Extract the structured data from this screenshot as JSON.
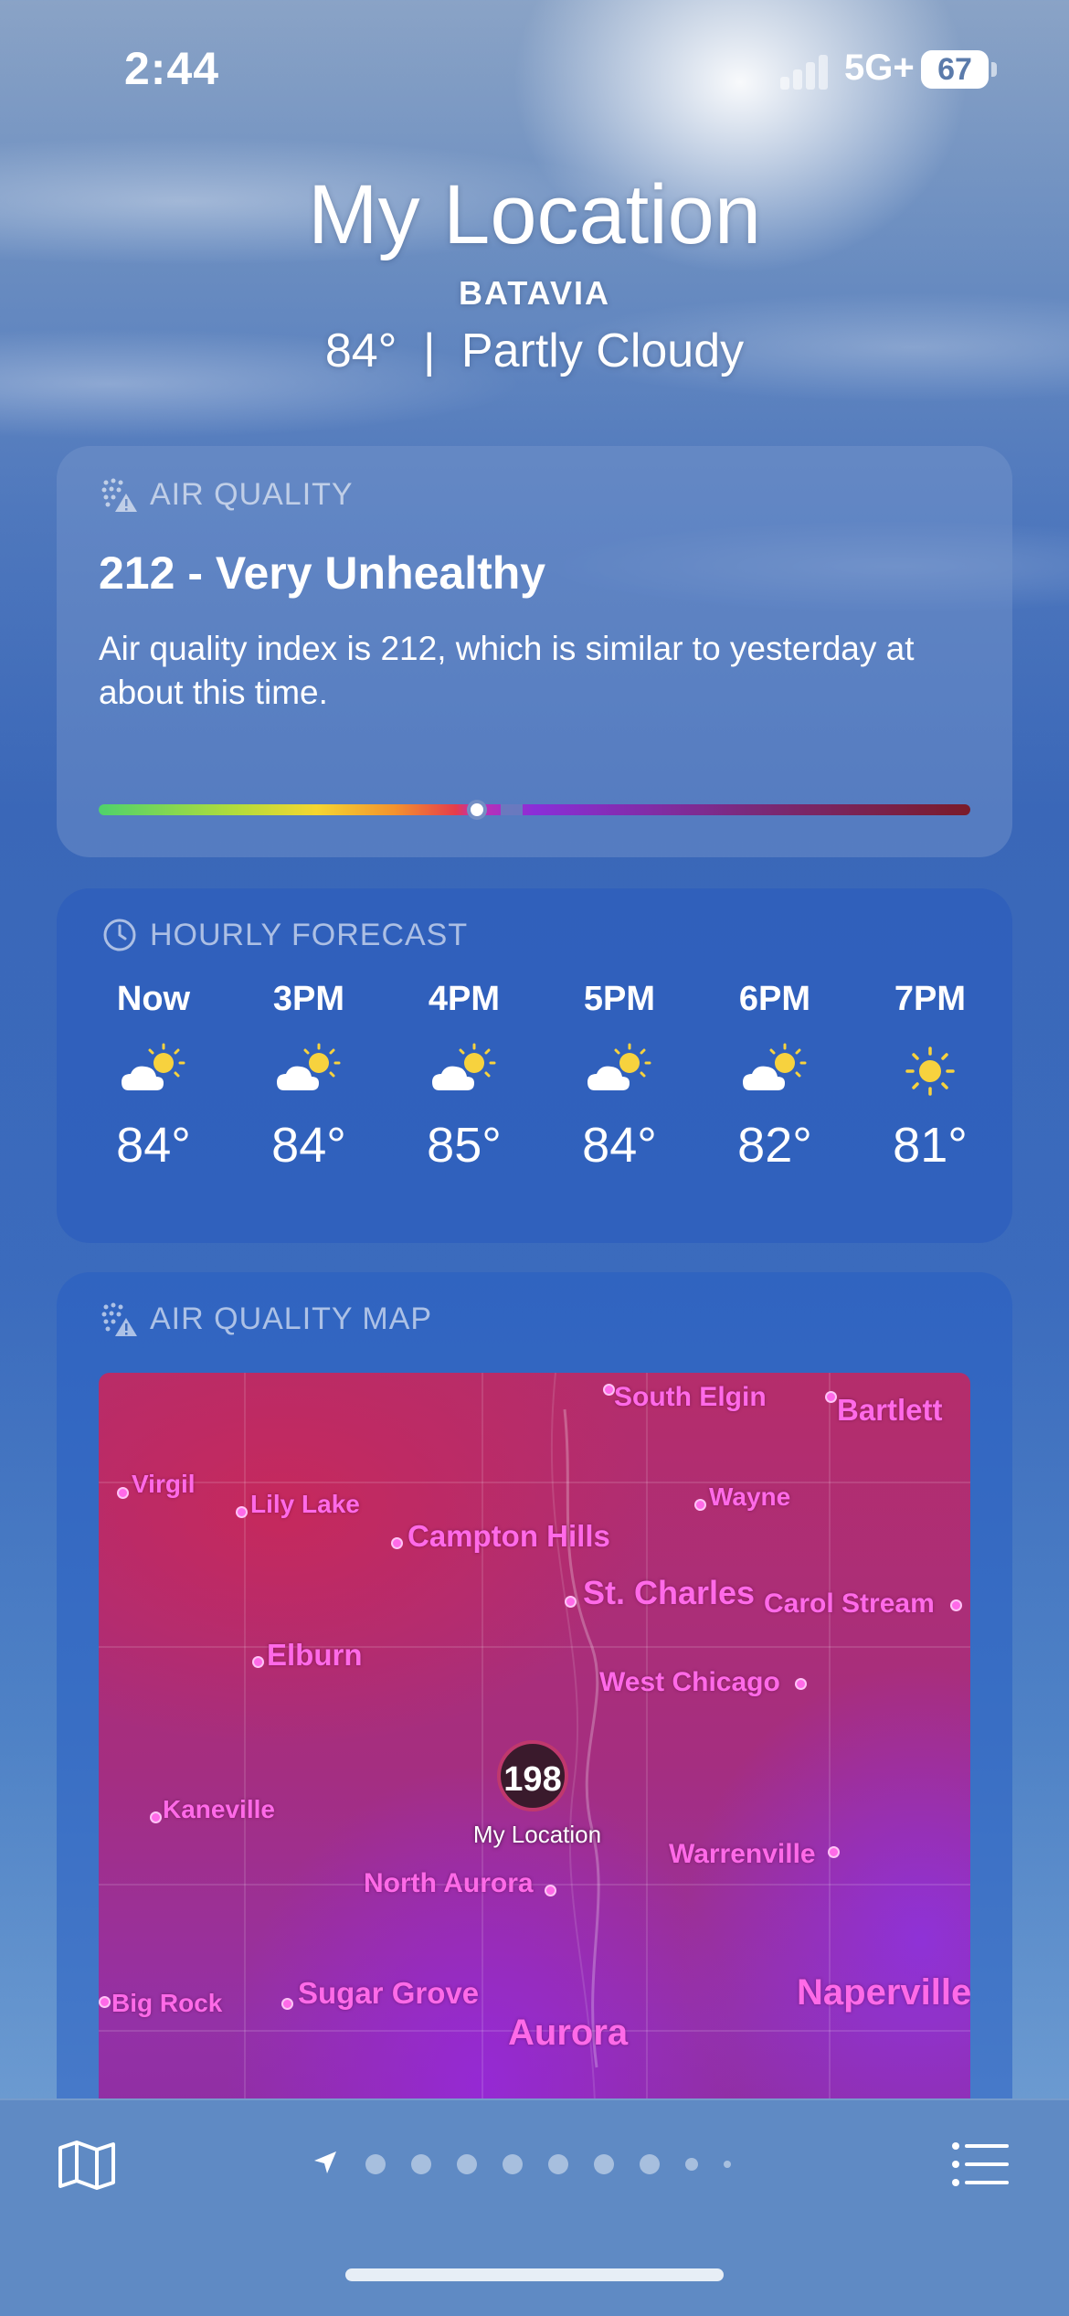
{
  "status": {
    "time": "2:44",
    "network": "5G+",
    "battery": "67"
  },
  "header": {
    "title": "My Location",
    "city": "BATAVIA",
    "temp": "84°",
    "separator": "|",
    "condition": "Partly Cloudy"
  },
  "air_quality": {
    "label": "AIR QUALITY",
    "value": "212 - Very Unhealthy",
    "description": "Air quality index is 212, which is similar to yesterday at about this time.",
    "index": 212,
    "icon": "air-quality-icon"
  },
  "hourly": {
    "label": "HOURLY FORECAST",
    "icon": "clock-icon",
    "hours": [
      {
        "time": "Now",
        "icon": "partly-cloudy-icon",
        "temp": "84°"
      },
      {
        "time": "3PM",
        "icon": "partly-cloudy-icon",
        "temp": "84°"
      },
      {
        "time": "4PM",
        "icon": "partly-cloudy-icon",
        "temp": "85°"
      },
      {
        "time": "5PM",
        "icon": "partly-cloudy-icon",
        "temp": "84°"
      },
      {
        "time": "6PM",
        "icon": "partly-cloudy-icon",
        "temp": "82°"
      },
      {
        "time": "7PM",
        "icon": "sun-icon",
        "temp": "81°"
      }
    ]
  },
  "aq_map": {
    "label": "AIR QUALITY MAP",
    "pin_value": "198",
    "pin_label": "My Location",
    "places": [
      "South Elgin",
      "Bartlett",
      "Virgil",
      "Lily Lake",
      "Wayne",
      "Campton Hills",
      "St. Charles",
      "Carol Stream",
      "Elburn",
      "West Chicago",
      "Kaneville",
      "Warrenville",
      "North Aurora",
      "Sugar Grove",
      "Big Rock",
      "Aurora",
      "Naperville"
    ]
  },
  "bottom_bar": {
    "map_icon": "map-icon",
    "list_icon": "list-icon",
    "page_count": 9
  },
  "colors": {
    "aq_high": "#7a1b2a",
    "map_label": "#ff6ae8",
    "sun": "#f7d23e"
  }
}
